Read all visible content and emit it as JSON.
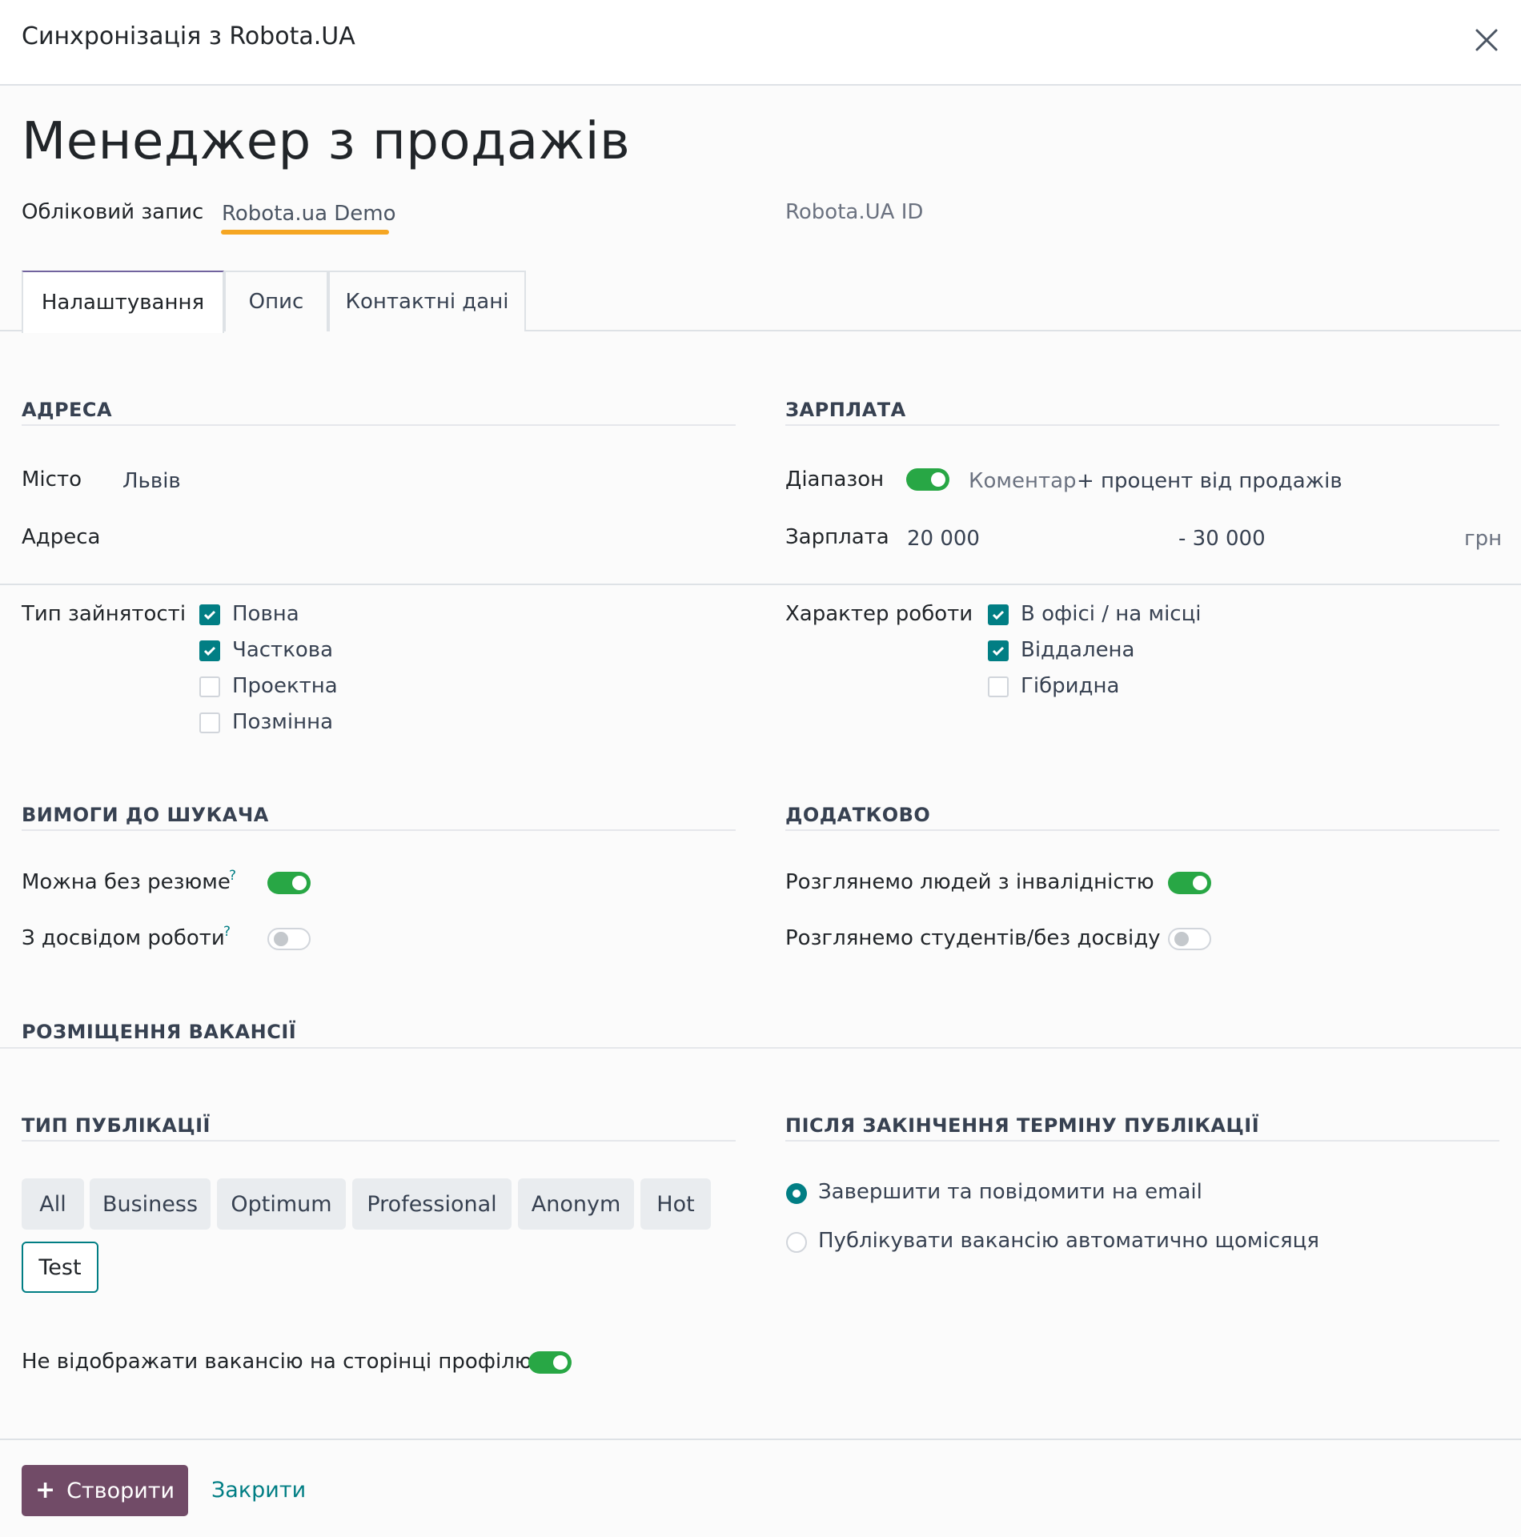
{
  "dialog": {
    "title": "Синхронізація з Robota.UA"
  },
  "record": {
    "title": "Менеджер з продажів",
    "account_label": "Обліковий запис",
    "account_value": "Robota.ua Demo",
    "robota_id_label": "Robota.UA ID"
  },
  "tabs": [
    {
      "label": "Налаштування",
      "active": true
    },
    {
      "label": "Опис",
      "active": false
    },
    {
      "label": "Контактні дані",
      "active": false
    }
  ],
  "address": {
    "heading": "АДРЕСА",
    "city_label": "Місто",
    "city_value": "Львів",
    "address_label": "Адреса"
  },
  "salary": {
    "heading": "ЗАРПЛАТА",
    "range_label": "Діапазон",
    "range_enabled": true,
    "comment_placeholder": "Коментар",
    "comment_value": "+ процент від продажів",
    "salary_label": "Зарплата",
    "salary_from": "20 000",
    "salary_to": "- 30 000",
    "currency": "грн"
  },
  "employment": {
    "label": "Тип зайнятості",
    "options": [
      {
        "label": "Повна",
        "checked": true
      },
      {
        "label": "Часткова",
        "checked": true
      },
      {
        "label": "Проектна",
        "checked": false
      },
      {
        "label": "Позмінна",
        "checked": false
      }
    ]
  },
  "work_nature": {
    "label": "Характер роботи",
    "options": [
      {
        "label": "В офісі / на місці",
        "checked": true
      },
      {
        "label": "Віддалена",
        "checked": true
      },
      {
        "label": "Гібридна",
        "checked": false
      }
    ]
  },
  "requirements": {
    "heading": "ВИМОГИ ДО ШУКАЧА",
    "no_resume_label": "Можна без резюме",
    "no_resume": true,
    "experience_label": "З досвідом роботи",
    "experience": false,
    "help_mark": "?"
  },
  "additional": {
    "heading": "ДОДАТКОВО",
    "disabilities_label": "Розглянемо людей з інвалідністю",
    "disabilities": true,
    "students_label": "Розглянемо студентів/без досвіду",
    "students": false
  },
  "placement": {
    "heading": "РОЗМІЩЕННЯ ВАКАНСІЇ",
    "pub_type_heading": "ТИП ПУБЛІКАЦІЇ",
    "pub_types": [
      "All",
      "Business",
      "Optimum",
      "Professional",
      "Anonym",
      "Hot",
      "Test"
    ],
    "selected_pub_type": "Test",
    "after_heading": "ПІСЛЯ ЗАКІНЧЕННЯ ТЕРМІНУ ПУБЛІКАЦІЇ",
    "after_options": [
      {
        "label": "Завершити та повідомити на email",
        "selected": true
      },
      {
        "label": "Публікувати вакансію автоматично щомісяця",
        "selected": false
      }
    ],
    "hide_profile_label": "Не відображати вакансію на сторінці профілю",
    "hide_profile": true
  },
  "footer": {
    "create_label": "Створити",
    "close_label": "Закрити"
  },
  "colors": {
    "primary": "#714b67",
    "accent": "#017e84",
    "toggle_on": "#28a745",
    "underline": "#f5a623"
  }
}
